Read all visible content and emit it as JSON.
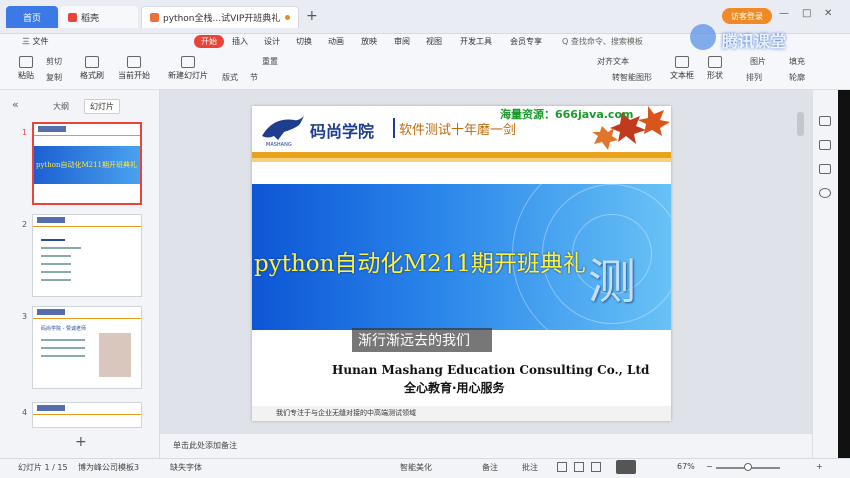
{
  "tabs": {
    "home": "首页",
    "daoke": "稻壳",
    "doc": "python全栈...试VIP开班典礼",
    "add": "+"
  },
  "window": {
    "login": "访客登录",
    "minimize": "—",
    "maximize": "□",
    "close": "✕"
  },
  "menu": {
    "file": "三 文件",
    "start": "开始",
    "insert": "插入",
    "design": "设计",
    "switch": "切换",
    "animation": "动画",
    "slideshow": "放映",
    "review": "审阅",
    "view": "视图",
    "devtools": "开发工具",
    "member": "会员专享",
    "search": "Q 查找命令、搜索模板"
  },
  "toolbar": {
    "paste": "粘贴",
    "cut": "剪切",
    "copy": "复制",
    "format_painter": "格式刷",
    "from_current": "当前开始",
    "new_slide": "新建幻灯片",
    "layout": "版式",
    "section": "节",
    "reset": "重置",
    "align_text": "对齐文本",
    "convert_smartart": "转智能图形",
    "textbox": "文本框",
    "shape": "形状",
    "arrange": "排列",
    "picture": "图片",
    "fill": "填充",
    "outline": "轮廓"
  },
  "left_panel": {
    "outline_tab": "大纲",
    "slides_tab": "幻灯片",
    "collapse": "«",
    "slide_numbers": [
      "1",
      "2",
      "3",
      "4"
    ],
    "thumb1_title": "python自动化M211期开班典礼",
    "thumb3_title": "码尚学院 - 赞诚老师",
    "add_slide": "+"
  },
  "slide": {
    "logo": "码尚学院",
    "logo_en": "MASHANG",
    "slogan": "软件测试十年磨一剑",
    "resource": "海量资源：666java.com",
    "title": "python自动化M211期开班典礼",
    "big_glyph": "测",
    "subtitle": "渐行渐远去的我们",
    "company_en": "Hunan Mashang Education Consulting Co., Ltd",
    "motto": "全心教育·用心服务",
    "focus": "我们专注于与企业无缝对接的中高端测试领域"
  },
  "notes": {
    "placeholder": "单击此处添加备注"
  },
  "status": {
    "slide_count": "幻灯片 1 / 15",
    "template": "博为峰公司模板3",
    "missing_font": "缺失字体",
    "smart_beautify": "智能美化",
    "notes": "备注",
    "comments": "批注",
    "zoom": "67%",
    "zoom_minus": "−",
    "zoom_plus": "+"
  },
  "watermark": {
    "text": "腾讯课堂"
  },
  "colors": {
    "accent": "#e8443a",
    "tab_active": "#3c79e6",
    "slide_title": "#fff23a",
    "slide_band": "#1d5fd2"
  }
}
